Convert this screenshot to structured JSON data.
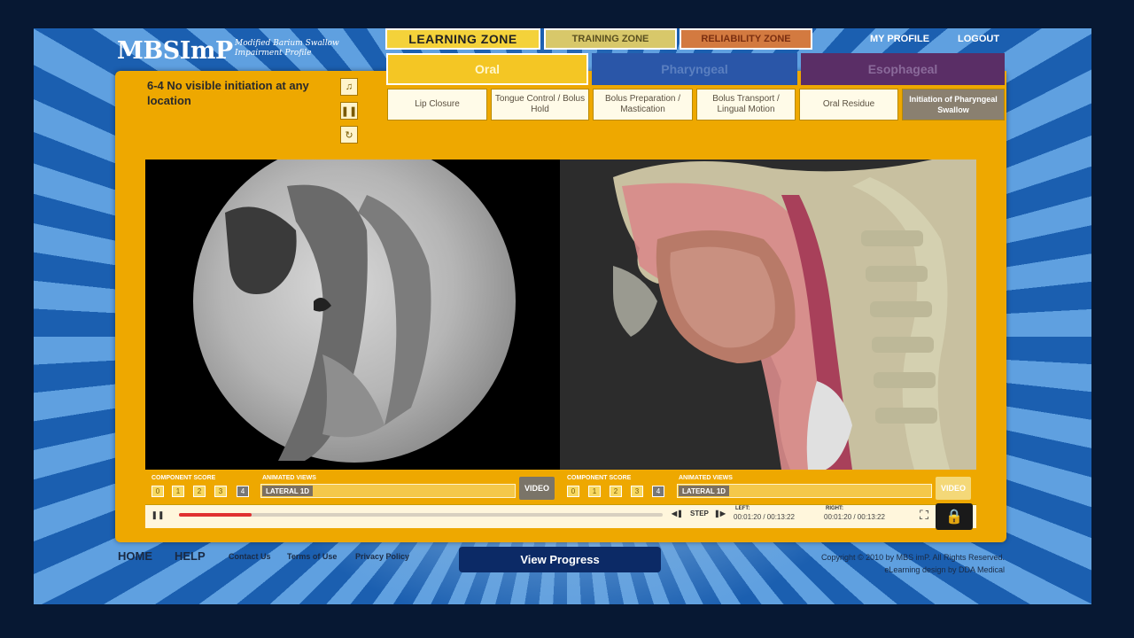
{
  "logo": {
    "text": "MBSImP",
    "subtitle": "Modified Barium Swallow Impairment Profile"
  },
  "zones": {
    "learning": "LEARNING ZONE",
    "training": "TRAINING ZONE",
    "reliability": "RELIABILITY ZONE"
  },
  "top_links": {
    "profile": "MY PROFILE",
    "logout": "LOGOUT"
  },
  "phases": {
    "oral": "Oral",
    "pharyngeal": "Pharyngeal",
    "esophageal": "Esophageal"
  },
  "components": [
    "Lip Closure",
    "Tongue Control / Bolus Hold",
    "Bolus Preparation / Mastication",
    "Bolus Transport / Lingual Motion",
    "Oral Residue",
    "Initiation of Pharyngeal Swallow"
  ],
  "lesson_title": "6-4 No visible initiation at any location",
  "side_buttons": {
    "audio": "speaker-icon",
    "pause": "pause-icon",
    "replay": "replay-icon"
  },
  "left_controls": {
    "score_label": "COMPONENT SCORE",
    "scores": [
      "0",
      "1",
      "2",
      "3",
      "4"
    ],
    "views_label": "ANIMATED VIEWS",
    "active_view": "LATERAL 1D",
    "video": "VIDEO"
  },
  "right_controls": {
    "score_label": "COMPONENT SCORE",
    "scores": [
      "0",
      "1",
      "2",
      "3",
      "4"
    ],
    "views_label": "ANIMATED VIEWS",
    "active_view": "LATERAL 1D",
    "video": "VIDEO"
  },
  "playback": {
    "progress": 0.15,
    "step": "STEP",
    "left_label": "LEFT:",
    "right_label": "RIGHT:",
    "left_time": "00:01:20 / 00:13:22",
    "right_time": "00:01:20 / 00:13:22"
  },
  "footer": {
    "home": "HOME",
    "help": "HELP",
    "contact": "Contact Us",
    "terms": "Terms of Use",
    "privacy": "Privacy Policy",
    "progress_button": "View Progress",
    "copyright": "Copyright © 2010 by MBS imP. All Rights Reserved.",
    "credit": "eLearning design by DDA Medical"
  },
  "colors": {
    "accent": "#eea800",
    "learning_tab": "#f4d23a",
    "pharyngeal": "#2a56a8",
    "esophageal": "#5a2e66",
    "progress_button": "#0c2a66"
  }
}
